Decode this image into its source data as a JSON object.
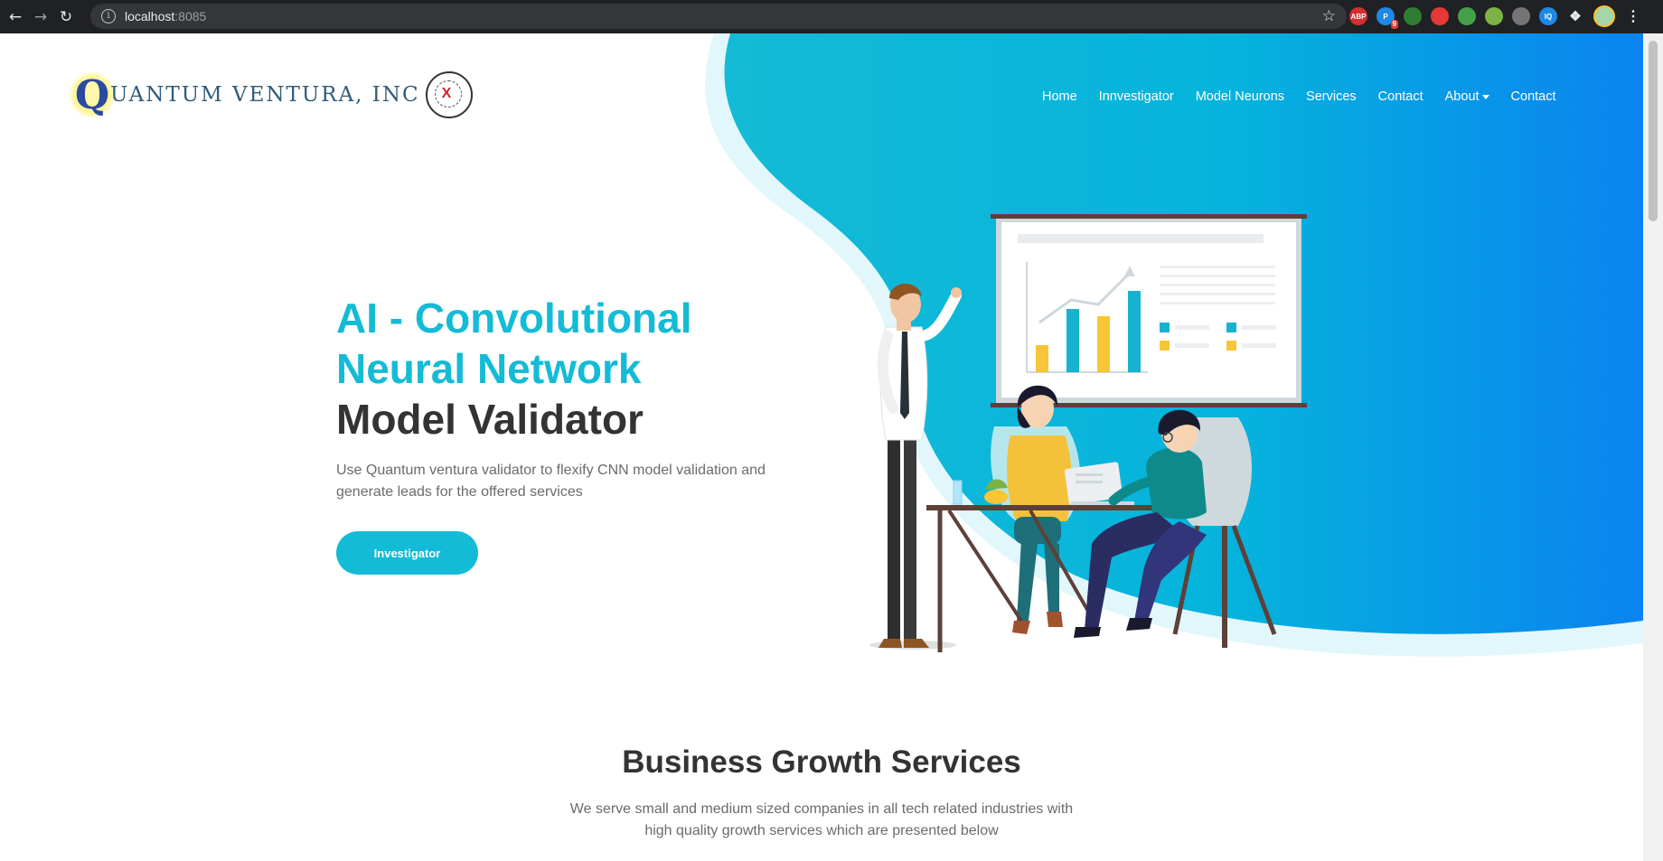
{
  "browser": {
    "url_host": "localhost",
    "url_port": ":8085",
    "extensions": [
      {
        "name": "adblock-plus",
        "label": "ABP",
        "color": "#d32f2f"
      },
      {
        "name": "extension-p",
        "label": "P",
        "color": "#1e88e5",
        "badge": "9"
      },
      {
        "name": "extension-leaf",
        "label": "",
        "color": "#2e7d32"
      },
      {
        "name": "extension-hand",
        "label": "",
        "color": "#e53935"
      },
      {
        "name": "extension-green",
        "label": "",
        "color": "#43a047"
      },
      {
        "name": "extension-cube",
        "label": "",
        "color": "#7cb342"
      },
      {
        "name": "extension-grey",
        "label": "",
        "color": "#757575"
      },
      {
        "name": "extension-iq",
        "label": "IQ",
        "color": "#1e88e5"
      }
    ]
  },
  "header": {
    "logo_text": "UANTUM VENTURA, INC",
    "logo_letter": "Q",
    "nav": [
      {
        "label": "Home"
      },
      {
        "label": "Innvestigator"
      },
      {
        "label": "Model Neurons"
      },
      {
        "label": "Services"
      },
      {
        "label": "Contact"
      },
      {
        "label": "About"
      },
      {
        "label": "Contact"
      }
    ]
  },
  "hero": {
    "title_line1": "AI - Convolutional",
    "title_line2": "Neural Network",
    "title_line3": "Model Validator",
    "description": "Use Quantum ventura validator to flexify CNN model validation and generate leads for the offered services",
    "button_label": "Investigator"
  },
  "services": {
    "title": "Business Growth Services",
    "description_line1": "We serve small and medium sized companies in all tech related industries with",
    "description_line2": "high quality growth services which are presented below"
  },
  "colors": {
    "accent": "#14bbd6",
    "gradient_end": "#0a83f0",
    "heading_dark": "#333333"
  }
}
